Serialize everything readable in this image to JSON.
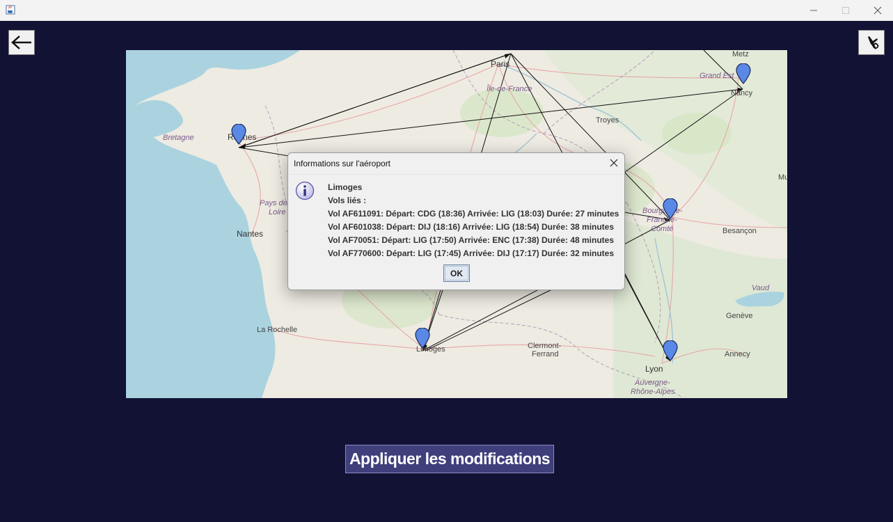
{
  "window": {
    "app_icon": "java-coffee-icon",
    "controls": [
      "minimize-icon",
      "maximize-icon",
      "close-icon"
    ]
  },
  "toolbar": {
    "back_icon": "arrow-left-icon",
    "settings_icon": "airplane-gear-icon"
  },
  "map": {
    "cities": [
      "Paris",
      "Metz",
      "Nancy",
      "Rennes",
      "Troyes",
      "Nantes",
      "Besançon",
      "La Rochelle",
      "Limoges",
      "Clermont-Ferrand",
      "Lyon",
      "Genève",
      "Annecy",
      "Mu"
    ],
    "city_lines": {
      "clermont_1": "Clermont-",
      "clermont_2": "Ferrand",
      "besancon": "Besançon"
    },
    "regions": {
      "bretagne": "Bretagne",
      "ile_de_france": "Île-de-France",
      "grand_est": "Grand Est",
      "pays_de_loire_1": "Pays de",
      "pays_de_loire_2": "Loire",
      "bourgogne_1": "Bourgogne-",
      "bourgogne_2": "Franche-",
      "bourgogne_3": "Comté",
      "auvergne_1": "Auvergne-",
      "auvergne_2": "Rhône-Alpes",
      "vaud": "Vaud"
    },
    "pin_color": "#5a88e6"
  },
  "dialog": {
    "title": "Informations sur l'aéroport",
    "icon": "info-icon",
    "airport": "Limoges",
    "flights_header": "Vols liés :",
    "flights": [
      "Vol AF611091:  Départ: CDG (18:36)  Arrivée: LIG (18:03)  Durée: 27 minutes",
      "Vol AF601038:  Départ: DIJ (18:16)  Arrivée: LIG (18:54)  Durée: 38 minutes",
      "Vol AF70051:  Départ: LIG (17:50)  Arrivée: ENC (17:38)  Durée: 48 minutes",
      "Vol AF770600:  Départ: LIG (17:45)  Arrivée: DIJ (17:17)  Durée: 32 minutes"
    ],
    "ok_label": "OK"
  },
  "apply_label": "Appliquer les modifications"
}
